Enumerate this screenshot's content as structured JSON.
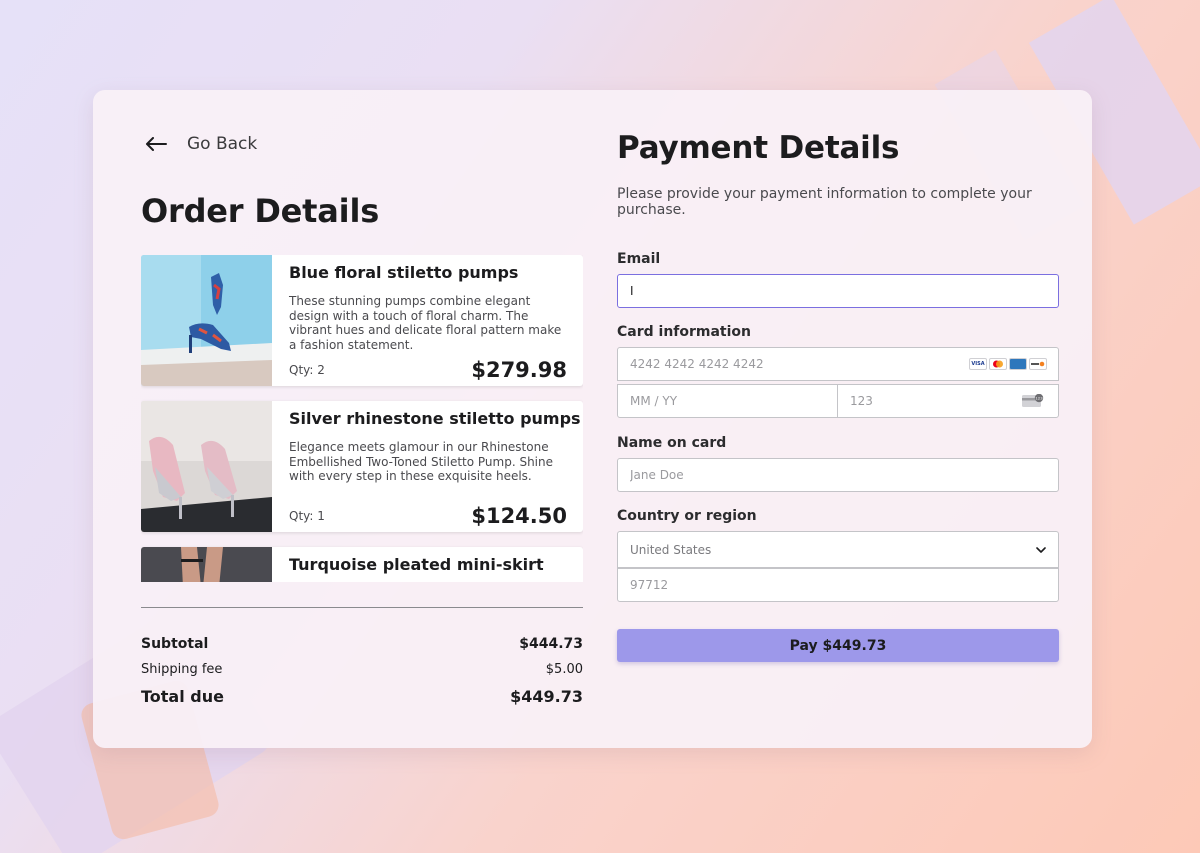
{
  "nav": {
    "back_label": "Go Back"
  },
  "order": {
    "title": "Order Details",
    "items": [
      {
        "name": "Blue floral stiletto pumps",
        "description": "These stunning pumps combine elegant design with a touch of floral charm. The vibrant hues and delicate floral pattern make a fashion statement.",
        "qty": "Qty: 2",
        "price": "$279.98"
      },
      {
        "name": "Silver rhinestone stiletto pumps",
        "description": "Elegance meets glamour in our Rhinestone Embellished Two-Toned Stiletto Pump. Shine with every step in these exquisite heels.",
        "qty": "Qty: 1",
        "price": "$124.50"
      },
      {
        "name": "Turquoise pleated mini-skirt"
      }
    ],
    "summary": {
      "subtotal_label": "Subtotal",
      "subtotal_value": "$444.73",
      "shipping_label": "Shipping fee",
      "shipping_value": "$5.00",
      "total_label": "Total due",
      "total_value": "$449.73"
    }
  },
  "payment": {
    "title": "Payment Details",
    "subtitle": "Please provide your payment information to complete your purchase.",
    "email_label": "Email",
    "email_value": "I",
    "card_label": "Card information",
    "card_number_placeholder": "4242 4242 4242 4242",
    "expiry_placeholder": "MM / YY",
    "cvc_placeholder": "123",
    "card_brands": [
      "VISA",
      "mastercard",
      "amex",
      "discover"
    ],
    "name_label": "Name on card",
    "name_placeholder": "Jane Doe",
    "country_label": "Country or region",
    "country_value": "United States",
    "zip_placeholder": "97712",
    "pay_button": "Pay $449.73"
  },
  "colors": {
    "accent": "#9d98ea",
    "focus_border": "#7b6fe0"
  }
}
